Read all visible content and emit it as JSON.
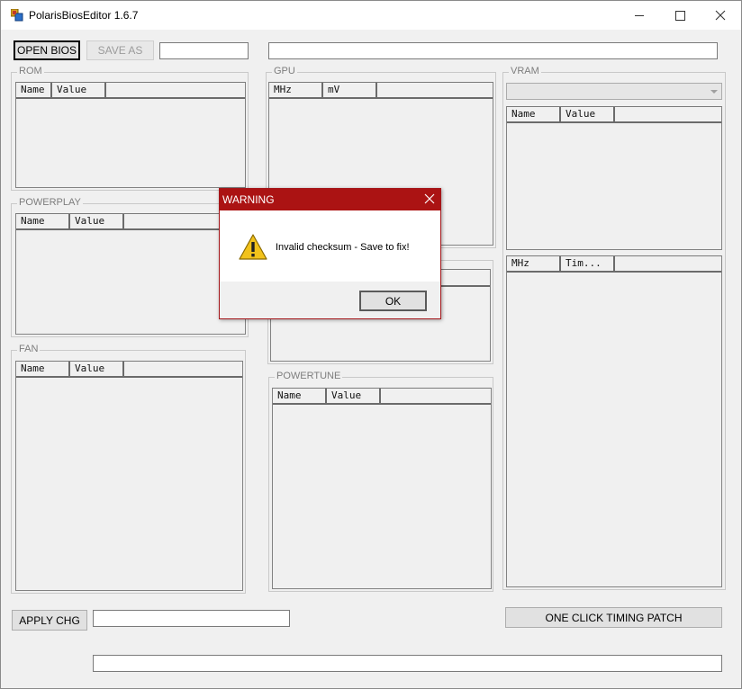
{
  "window": {
    "title": "PolarisBiosEditor 1.6.7"
  },
  "toolbar": {
    "open_bios": "OPEN BIOS",
    "save_as": "SAVE AS",
    "apply_chg": "APPLY CHG",
    "timing_patch": "ONE CLICK TIMING PATCH"
  },
  "groups": {
    "rom": {
      "caption": "ROM",
      "columns": [
        "Name",
        "Value"
      ]
    },
    "powerplay": {
      "caption": "POWERPLAY",
      "columns": [
        "Name",
        "Value"
      ]
    },
    "fan": {
      "caption": "FAN",
      "columns": [
        "Name",
        "Value"
      ]
    },
    "gpu": {
      "caption": "GPU",
      "columns": [
        "MHz",
        "mV"
      ]
    },
    "powertune": {
      "caption": "POWERTUNE",
      "columns": [
        "Name",
        "Value"
      ]
    },
    "vram": {
      "caption": "VRAM",
      "columns": [
        "Name",
        "Value"
      ],
      "timing_columns": [
        "MHz",
        "Tim..."
      ]
    }
  },
  "dialog": {
    "title": "WARNING",
    "message": "Invalid checksum - Save to fix!",
    "ok": "OK"
  }
}
